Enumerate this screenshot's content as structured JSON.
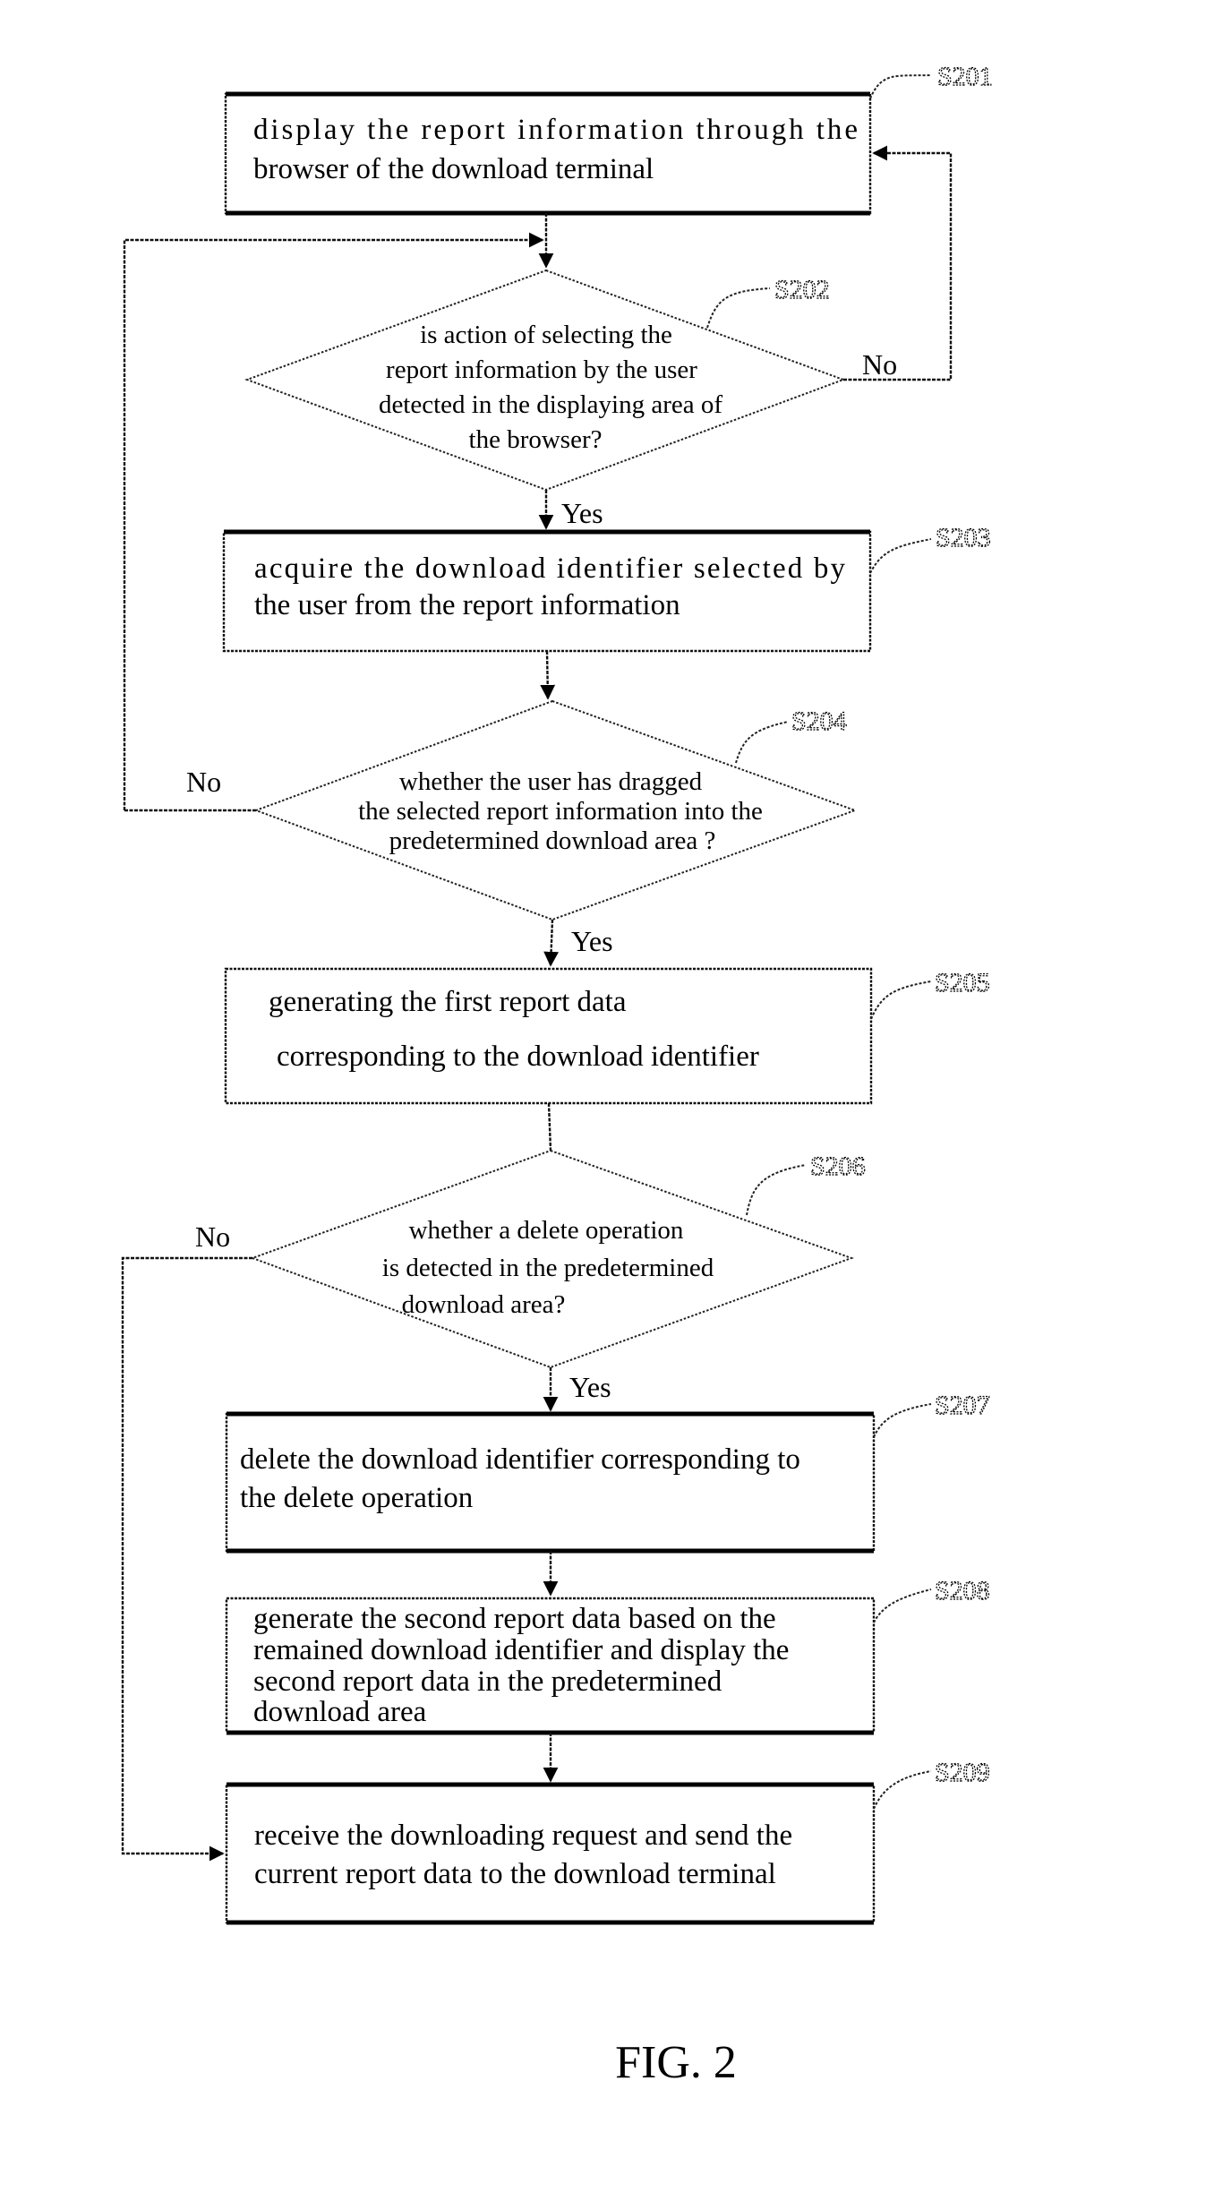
{
  "figure": {
    "caption": "FIG. 2",
    "type": "flowchart"
  },
  "steps": [
    {
      "id": "S201",
      "kind": "process",
      "lines": [
        "display  the  report  information  through  the",
        "browser of the download terminal"
      ]
    },
    {
      "id": "S202",
      "kind": "decision",
      "lines": [
        "is  action of selecting the",
        "report information by the user",
        "detected in the displaying area of",
        "the browser?"
      ],
      "yes_label": "Yes",
      "no_label": "No"
    },
    {
      "id": "S203",
      "kind": "process",
      "lines": [
        "acquire  the  download  identifier  selected  by",
        "the user from the report information"
      ]
    },
    {
      "id": "S204",
      "kind": "decision",
      "lines": [
        "whether the user has dragged",
        "the selected report information into the",
        "predetermined download area ?"
      ],
      "yes_label": "Yes",
      "no_label": "No"
    },
    {
      "id": "S205",
      "kind": "process",
      "lines": [
        "generating the first report data",
        "corresponding to the download identifier"
      ]
    },
    {
      "id": "S206",
      "kind": "decision",
      "lines": [
        "whether a delete operation",
        "is detected in the predetermined",
        "download area?"
      ],
      "yes_label": "Yes",
      "no_label": "No"
    },
    {
      "id": "S207",
      "kind": "process",
      "lines": [
        "delete the download identifier corresponding to",
        "the delete operation"
      ]
    },
    {
      "id": "S208",
      "kind": "process",
      "lines": [
        "generate the second report data based on the",
        "remained download identifier and display the",
        "second report data in the predetermined",
        "download area"
      ]
    },
    {
      "id": "S209",
      "kind": "process",
      "lines": [
        "receive the downloading request and send the",
        "current report data to the download terminal"
      ]
    }
  ]
}
